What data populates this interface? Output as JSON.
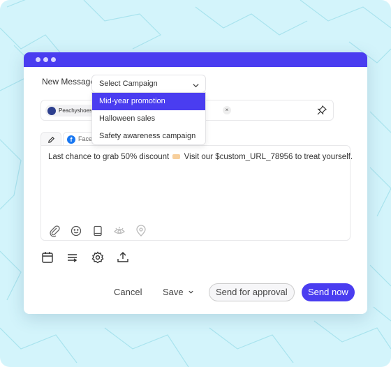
{
  "window": {
    "title_dots": 3,
    "accent_color": "#4a3df0"
  },
  "compose": {
    "label": "New Message",
    "campaign_select": {
      "value": "Select Campaign",
      "options": [
        {
          "label": "Mid-year promotion",
          "active": true
        },
        {
          "label": "Halloween sales",
          "active": false
        },
        {
          "label": "Safety awareness campaign",
          "active": false
        }
      ]
    },
    "recipients": [
      {
        "name": "Peachyshoes",
        "remove_label": "×"
      }
    ],
    "tabs": [
      {
        "icon": "pencil-icon",
        "label": ""
      },
      {
        "icon": "facebook-icon",
        "label": "Face"
      }
    ],
    "message": {
      "before": "Last chance to grab 50% discount",
      "after": "Visit our $custom_URL_78956 to treat yourself."
    },
    "editor_icons": [
      "paperclip-icon",
      "emoji-icon",
      "book-icon",
      "eye-icon",
      "location-pin-icon"
    ],
    "tool_icons": [
      "calendar-icon",
      "queue-icon",
      "gear-icon",
      "upload-icon"
    ]
  },
  "footer": {
    "cancel": "Cancel",
    "save": "Save",
    "send_for_approval": "Send for approval",
    "send_now": "Send now"
  }
}
